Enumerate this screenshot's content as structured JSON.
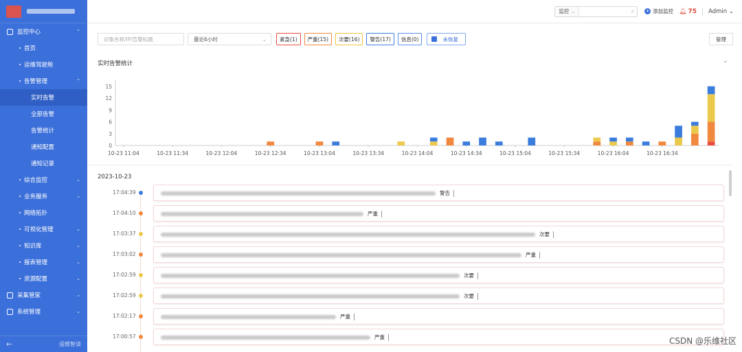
{
  "sidebar": {
    "menu": [
      {
        "label": "监控中心",
        "level": 1,
        "chevron": "⌃"
      },
      {
        "label": "首页",
        "level": 2
      },
      {
        "label": "运维驾驶舱",
        "level": 2
      },
      {
        "label": "告警管理",
        "level": 2,
        "chevron": "⌃"
      },
      {
        "label": "实时告警",
        "level": 3,
        "active": true
      },
      {
        "label": "全部告警",
        "level": 3
      },
      {
        "label": "告警统计",
        "level": 3
      },
      {
        "label": "通知配置",
        "level": 3
      },
      {
        "label": "通知记录",
        "level": 3
      },
      {
        "label": "综合监控",
        "level": 2,
        "chevron": "⌄"
      },
      {
        "label": "业务服务",
        "level": 2,
        "chevron": "⌄"
      },
      {
        "label": "网络拓扑",
        "level": 2
      },
      {
        "label": "可视化管理",
        "level": 2,
        "chevron": "⌄"
      },
      {
        "label": "知识库",
        "level": 2,
        "chevron": "⌄"
      },
      {
        "label": "报表管理",
        "level": 2,
        "chevron": "⌄"
      },
      {
        "label": "资源配置",
        "level": 2,
        "chevron": "⌄"
      },
      {
        "label": "采集管家",
        "level": 1,
        "chevron": "⌄"
      },
      {
        "label": "系统管理",
        "level": 1,
        "chevron": "⌄"
      }
    ],
    "bottom_label": "运维智谈"
  },
  "header": {
    "search_type": "监控",
    "add_monitor": "添加监控",
    "bell_count": "75",
    "user": "Admin"
  },
  "filters": {
    "search_placeholder": "对象名称/IP/告警标题",
    "time_range": "最近6小时",
    "tags": [
      {
        "label": "紧急(1)",
        "color": "#e74c3c"
      },
      {
        "label": "严重(15)",
        "color": "#f0883e"
      },
      {
        "label": "次要(16)",
        "color": "#f0c23c"
      },
      {
        "label": "警告(17)",
        "color": "#3b7ddd"
      },
      {
        "label": "信息(0)",
        "color": "#5b8def"
      }
    ],
    "unrecovered": "未恢复",
    "manage": "管理"
  },
  "stats": {
    "title": "实时告警统计"
  },
  "chart_data": {
    "type": "bar",
    "stacked": true,
    "ylim": [
      0,
      16
    ],
    "yticks": [
      0,
      3,
      6,
      9,
      12,
      15
    ],
    "xtick_labels": [
      "10-23 11:04",
      "10-23 11:34",
      "10-23 12:04",
      "10-23 12:34",
      "10-23 13:04",
      "10-23 13:34",
      "10-23 14:04",
      "10-23 14:34",
      "10-23 15:04",
      "10-23 15:34",
      "10-23 16:04",
      "10-23 16:34"
    ],
    "series_colors": {
      "紧急": "#e74c3c",
      "严重": "#f0883e",
      "次要": "#ebc94c",
      "警告": "#3b7ddd"
    },
    "bars": [
      {
        "slot": 9,
        "紧急": 0,
        "严重": 1,
        "次要": 0,
        "警告": 0
      },
      {
        "slot": 12,
        "紧急": 0,
        "严重": 1,
        "次要": 0,
        "警告": 0
      },
      {
        "slot": 13,
        "紧急": 0,
        "严重": 0,
        "次要": 0,
        "警告": 1
      },
      {
        "slot": 17,
        "紧急": 0,
        "严重": 0,
        "次要": 1,
        "警告": 0
      },
      {
        "slot": 19,
        "紧急": 0,
        "严重": 0,
        "次要": 1,
        "警告": 1
      },
      {
        "slot": 20,
        "紧急": 0,
        "严重": 2,
        "次要": 0,
        "警告": 0
      },
      {
        "slot": 21,
        "紧急": 0,
        "严重": 0,
        "次要": 0,
        "警告": 1
      },
      {
        "slot": 22,
        "紧急": 0,
        "严重": 0,
        "次要": 0,
        "警告": 2
      },
      {
        "slot": 23,
        "紧急": 0,
        "严重": 0,
        "次要": 0,
        "警告": 1
      },
      {
        "slot": 25,
        "紧急": 0,
        "严重": 0,
        "次要": 0,
        "警告": 2
      },
      {
        "slot": 29,
        "紧急": 0,
        "严重": 1,
        "次要": 1,
        "警告": 0
      },
      {
        "slot": 30,
        "紧急": 0,
        "严重": 0,
        "次要": 1,
        "警告": 1
      },
      {
        "slot": 31,
        "紧急": 0,
        "严重": 1,
        "次要": 0,
        "警告": 1
      },
      {
        "slot": 32,
        "紧急": 0,
        "严重": 0,
        "次要": 0,
        "警告": 1
      },
      {
        "slot": 33,
        "紧急": 0,
        "严重": 1,
        "次要": 0,
        "警告": 0
      },
      {
        "slot": 34,
        "紧急": 0,
        "严重": 0,
        "次要": 2,
        "警告": 3
      },
      {
        "slot": 35,
        "紧急": 0,
        "严重": 3,
        "次要": 2,
        "警告": 1
      },
      {
        "slot": 36,
        "紧急": 1,
        "严重": 5,
        "次要": 7,
        "警告": 2
      }
    ]
  },
  "timeline": {
    "date": "2023-10-23",
    "rows": [
      {
        "time": "17:04:39",
        "level": "警告",
        "dot": "#3b7ddd",
        "blur": 400
      },
      {
        "time": "17:04:10",
        "level": "严重",
        "dot": "#f0883e",
        "blur": 295
      },
      {
        "time": "17:03:37",
        "level": "次要",
        "dot": "#ebc94c",
        "blur": 545
      },
      {
        "time": "17:03:02",
        "level": "严重",
        "dot": "#f0883e",
        "blur": 525
      },
      {
        "time": "17:02:59",
        "level": "次要",
        "dot": "#ebc94c",
        "blur": 435
      },
      {
        "time": "17:02:59",
        "level": "次要",
        "dot": "#ebc94c",
        "blur": 435
      },
      {
        "time": "17:02:17",
        "level": "严重",
        "dot": "#f0883e",
        "blur": 255
      },
      {
        "time": "17:00:57",
        "level": "严重",
        "dot": "#f0883e",
        "blur": 305
      }
    ]
  },
  "watermark": "CSDN @乐维社区"
}
